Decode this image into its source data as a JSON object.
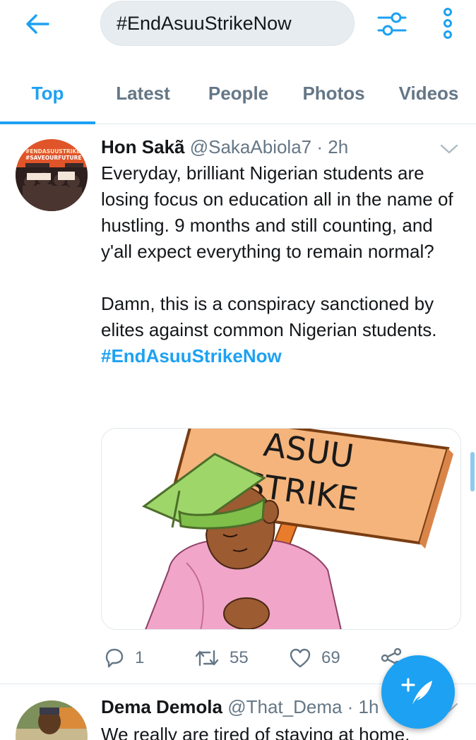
{
  "search": {
    "query": "#EndAsuuStrikeNow"
  },
  "tabs": [
    {
      "label": "Top"
    },
    {
      "label": "Latest"
    },
    {
      "label": "People"
    },
    {
      "label": "Photos"
    },
    {
      "label": "Videos"
    }
  ],
  "tweets": [
    {
      "name": "Hon Sakã",
      "handle": "@SakaAbiola7",
      "sep": " · ",
      "time": "2h",
      "paragraphs": [
        "Everyday, brilliant Nigerian students are losing focus on education all in the name of hustling. 9 months and still counting, and y'all expect everything to remain normal?",
        "Damn, this is a conspiracy sanctioned by elites against common Nigerian students."
      ],
      "hashtag": "#EndAsuuStrikeNow",
      "avatar_text": [
        "#ENDASUUSTRIKE",
        "#SAVEOURFUTURE"
      ],
      "media_sign": [
        "ASUU",
        "STRIKE"
      ],
      "stats": {
        "replies": "1",
        "retweets": "55",
        "likes": "69"
      }
    },
    {
      "name": "Dema Demola",
      "handle": "@That_Dema",
      "sep": " · ",
      "time": "1h",
      "text": "We really are tired of staying at home."
    }
  ],
  "colors": {
    "accent": "#1da1f2",
    "secondary_text": "#657786",
    "divider": "#e1e8ed"
  },
  "icons": [
    "back-arrow-icon",
    "filter-sliders-icon",
    "more-vertical-icon",
    "chevron-down-icon",
    "reply-icon",
    "retweet-icon",
    "like-heart-icon",
    "share-icon",
    "compose-tweet-icon"
  ]
}
